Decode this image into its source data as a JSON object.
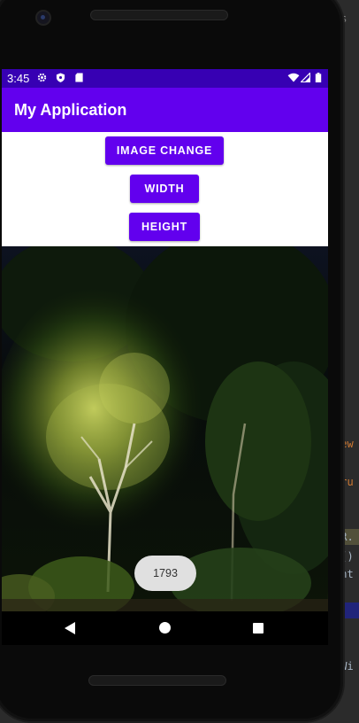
{
  "status_bar": {
    "time": "3:45",
    "left_icons": [
      "gear-icon",
      "shield-icon",
      "sd-card-icon"
    ],
    "right_icons": [
      "wifi-icon",
      "signal-icon",
      "battery-icon"
    ],
    "color": "#3700b3"
  },
  "app_bar": {
    "title": "My Application",
    "color": "#6200ee"
  },
  "buttons": {
    "image_change": "IMAGE CHANGE",
    "width": "WIDTH",
    "height": "HEIGHT"
  },
  "toast": {
    "text": "1793"
  },
  "ide_fragments": [
    "rs",
    "Y",
    "a",
    "iew",
    "tru",
    "(R.",
    "n()",
    "ght",
    "oWi"
  ],
  "nav_bar": {
    "icons": [
      "back-icon",
      "home-icon",
      "recents-icon"
    ]
  }
}
